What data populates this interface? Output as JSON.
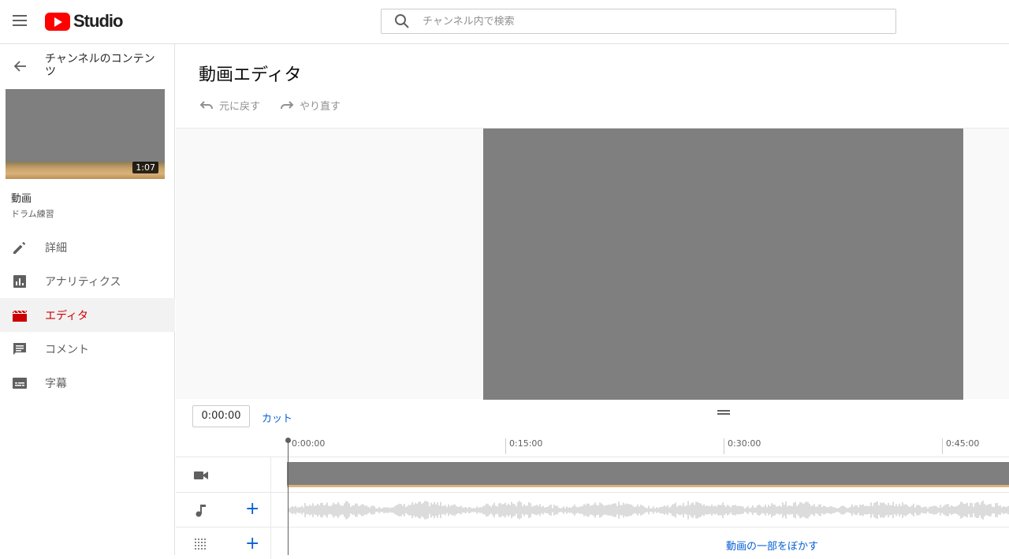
{
  "header": {
    "logo_text": "Studio",
    "search_placeholder": "チャンネル内で検索"
  },
  "sidebar": {
    "back_label": "チャンネルのコンテンツ",
    "thumbnail_duration": "1:07",
    "video_title": "動画",
    "video_subtitle": "ドラム練習",
    "nav": [
      {
        "label": "詳細",
        "icon": "pencil-icon"
      },
      {
        "label": "アナリティクス",
        "icon": "analytics-icon"
      },
      {
        "label": "エディタ",
        "icon": "clapperboard-icon",
        "active": true
      },
      {
        "label": "コメント",
        "icon": "comment-icon"
      },
      {
        "label": "字幕",
        "icon": "subtitles-icon"
      }
    ]
  },
  "main": {
    "title": "動画エディタ",
    "undo_label": "元に戻す",
    "redo_label": "やり直す",
    "timecode": "0:00:00",
    "cut_label": "カット",
    "ruler_ticks": [
      "0:00:00",
      "0:15:00",
      "0:30:00",
      "0:45:00"
    ],
    "blur_label": "動画の一部をぼかす",
    "add_symbol": "+"
  },
  "colors": {
    "accent_red": "#cc0000",
    "link_blue": "#065fd4",
    "video_gray": "#7f7f7f"
  }
}
